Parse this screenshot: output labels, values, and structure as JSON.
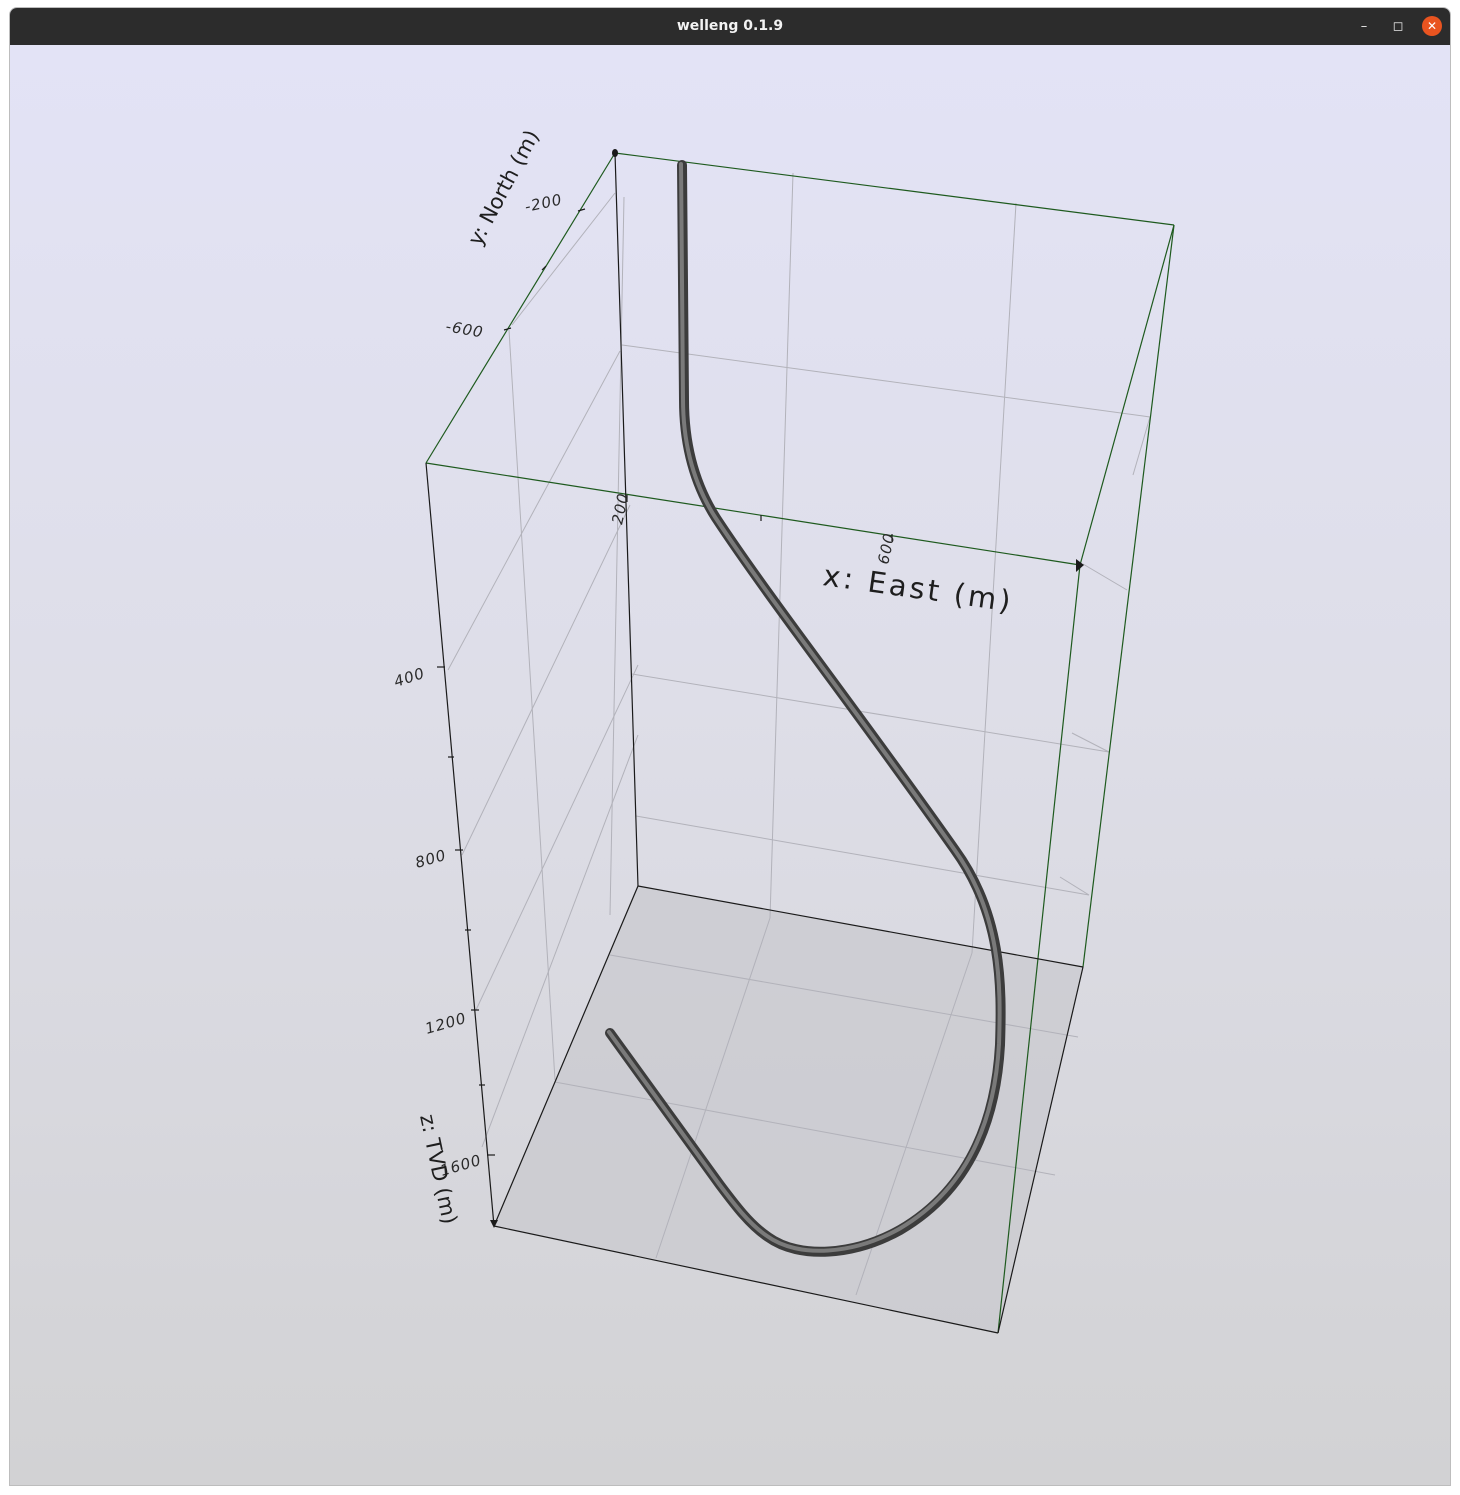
{
  "window": {
    "title": "welleng 0.1.9",
    "buttons": {
      "minimize_icon": "minimize-icon",
      "maximize_icon": "maximize-icon",
      "close_icon": "close-icon"
    }
  },
  "plot": {
    "x_axis": {
      "title": "x: East (m)",
      "ticks": [
        "200",
        "600"
      ]
    },
    "y_axis": {
      "title": "y: North (m)",
      "ticks": [
        "-200",
        "-600"
      ]
    },
    "z_axis": {
      "title": "z: TVD (m)",
      "ticks": [
        "400",
        "800",
        "1200",
        "1600"
      ]
    },
    "colors": {
      "bounding_box": "#1e5a1e",
      "axis_line": "#1a1a1a",
      "grid": "#b4b4bc",
      "floor": "#c8c8ce",
      "wellbore": "#5a5a5a"
    }
  }
}
